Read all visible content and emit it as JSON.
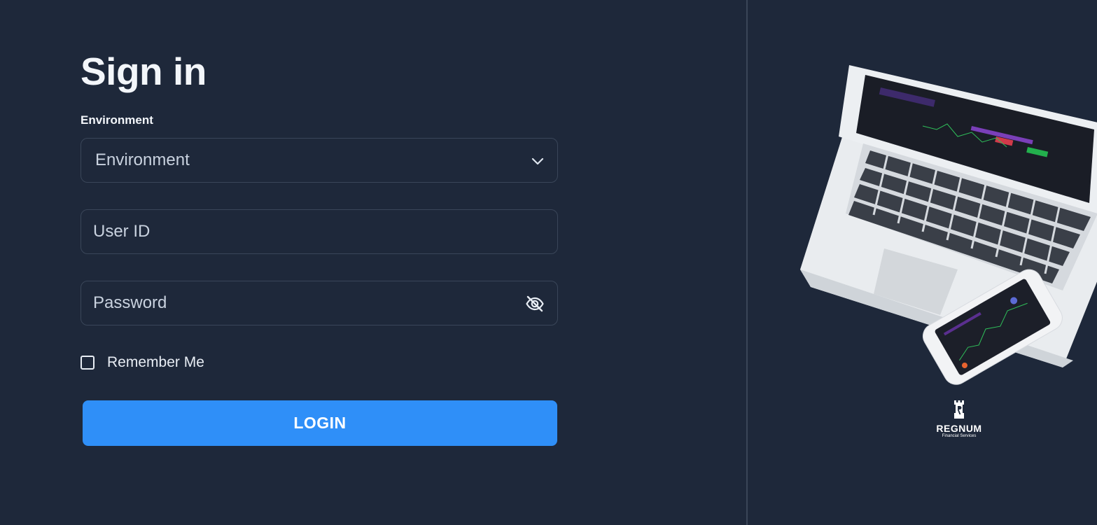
{
  "signin": {
    "title": "Sign in",
    "environment_label": "Environment",
    "environment_value": "Environment",
    "user_id_placeholder": "User ID",
    "password_placeholder": "Password",
    "remember_label": "Remember Me",
    "login_label": "LOGIN"
  },
  "brand": {
    "name": "REGNUM",
    "subtitle": "Financial Services"
  },
  "icons": {
    "select_chevron": "chevron-down-icon",
    "password_toggle": "eye-off-icon",
    "brand_logo": "rook-logo-icon"
  },
  "colors": {
    "background": "#1e283a",
    "field_border": "#3a4659",
    "primary_button": "#2f8ff8",
    "text": "#e8edf4"
  }
}
